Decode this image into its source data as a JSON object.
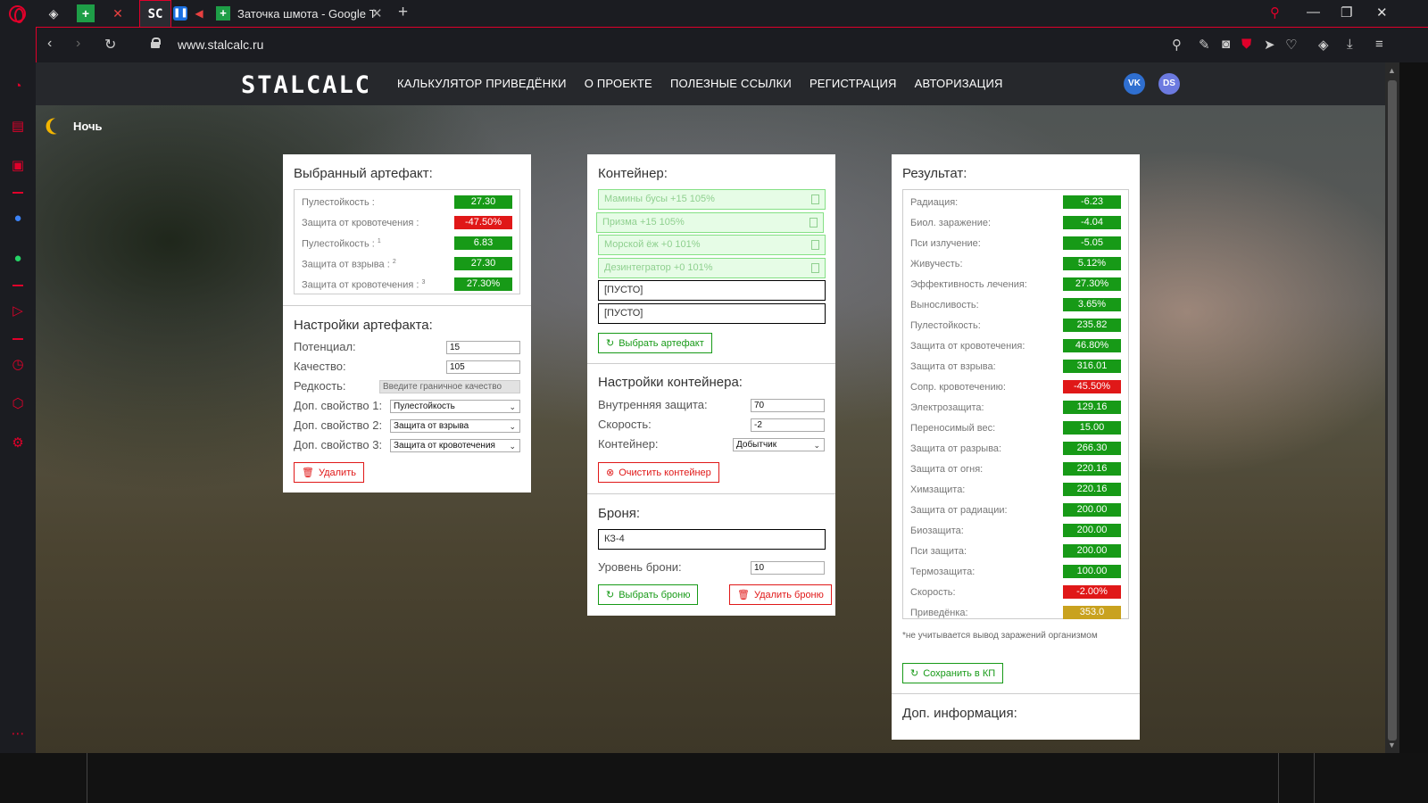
{
  "browser": {
    "tab_title": "Заточка шмота - Google Т",
    "active_tab_label": "SC",
    "url": "www.stalcalc.ru"
  },
  "site": {
    "logo": "STALCALC",
    "nav": [
      "КАЛЬКУЛЯТОР ПРИВЕДЁНКИ",
      "О ПРОЕКТЕ",
      "ПОЛЕЗНЫЕ ССЫЛКИ",
      "РЕГИСТРАЦИЯ",
      "АВТОРИЗАЦИЯ"
    ],
    "social": {
      "vk": "VK",
      "discord": "DS"
    },
    "night_label": "Ночь"
  },
  "artifact": {
    "title": "Выбранный артефакт:",
    "stats": [
      {
        "label": "Пулестойкость :",
        "value": "27.30",
        "color": "green"
      },
      {
        "label": "Защита от кровотечения :",
        "value": "-47.50%",
        "color": "red"
      },
      {
        "label": "Пулестойкость :",
        "sup": "1",
        "value": "6.83",
        "color": "green"
      },
      {
        "label": "Защита от взрыва :",
        "sup": "2",
        "value": "27.30",
        "color": "green"
      },
      {
        "label": "Защита от кровотечения :",
        "sup": "3",
        "value": "27.30%",
        "color": "green"
      }
    ],
    "settings_title": "Настройки артефакта:",
    "potential_label": "Потенциал:",
    "potential_value": "15",
    "quality_label": "Качество:",
    "quality_value": "105",
    "rarity_label": "Редкость:",
    "rarity_value": "Введите граничное качество",
    "extra1_label": "Доп. свойство 1:",
    "extra1_value": "Пулестойкость",
    "extra2_label": "Доп. свойство 2:",
    "extra2_value": "Защита от взрыва",
    "extra3_label": "Доп. свойство 3:",
    "extra3_value": "Защита от кровотечения",
    "delete_label": "Удалить"
  },
  "container": {
    "title": "Контейнер:",
    "slots": [
      "Мамины бусы +15 105%",
      "Призма +15 105%",
      "Морской ёж +0 101%",
      "Дезинтегратор +0 101%",
      "[ПУСТО]",
      "[ПУСТО]"
    ],
    "select_artifact_label": "Выбрать артефакт",
    "settings_title": "Настройки контейнера:",
    "inner_protection_label": "Внутренняя защита:",
    "inner_protection_value": "70",
    "speed_label": "Скорость:",
    "speed_value": "-2",
    "container_label": "Контейнер:",
    "container_value": "Добытчик",
    "clear_label": "Очистить контейнер"
  },
  "armor": {
    "title": "Броня:",
    "value": "КЗ-4",
    "level_label": "Уровень брони:",
    "level_value": "10",
    "select_label": "Выбрать броню",
    "delete_label": "Удалить броню"
  },
  "result": {
    "title": "Результат:",
    "stats": [
      {
        "label": "Радиация:",
        "value": "-6.23",
        "color": "green"
      },
      {
        "label": "Биол. заражение:",
        "value": "-4.04",
        "color": "green"
      },
      {
        "label": "Пси излучение:",
        "value": "-5.05",
        "color": "green"
      },
      {
        "label": "Живучесть:",
        "value": "5.12%",
        "color": "green"
      },
      {
        "label": "Эффективность лечения:",
        "value": "27.30%",
        "color": "green"
      },
      {
        "label": "Выносливость:",
        "value": "3.65%",
        "color": "green"
      },
      {
        "label": "Пулестойкость:",
        "value": "235.82",
        "color": "green"
      },
      {
        "label": "Защита от кровотечения:",
        "value": "46.80%",
        "color": "green"
      },
      {
        "label": "Защита от взрыва:",
        "value": "316.01",
        "color": "green"
      },
      {
        "label": "Сопр. кровотечению:",
        "value": "-45.50%",
        "color": "red"
      },
      {
        "label": "Электрозащита:",
        "value": "129.16",
        "color": "green"
      },
      {
        "label": "Переносимый вес:",
        "value": "15.00",
        "color": "green"
      },
      {
        "label": "Защита от разрыва:",
        "value": "266.30",
        "color": "green"
      },
      {
        "label": "Защита от огня:",
        "value": "220.16",
        "color": "green"
      },
      {
        "label": "Химзащита:",
        "value": "220.16",
        "color": "green"
      },
      {
        "label": "Защита от радиации:",
        "value": "200.00",
        "color": "green"
      },
      {
        "label": "Биозащита:",
        "value": "200.00",
        "color": "green"
      },
      {
        "label": "Пси защита:",
        "value": "200.00",
        "color": "green"
      },
      {
        "label": "Термозащита:",
        "value": "100.00",
        "color": "green"
      },
      {
        "label": "Скорость:",
        "value": "-2.00%",
        "color": "red"
      },
      {
        "label": "Приведёнка:",
        "value": "353.0",
        "color": "gold"
      }
    ],
    "note": "*не учитывается вывод заражений организмом",
    "save_label": "Сохранить в КП",
    "extra_title": "Доп. информация:"
  },
  "colors": {
    "accent": "#e0002a",
    "green": "#179a17",
    "red": "#e01818",
    "gold": "#c9a21f"
  }
}
